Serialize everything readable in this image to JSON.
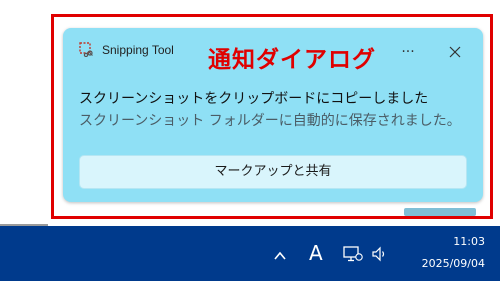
{
  "toast": {
    "app_name": "Snipping Tool",
    "annotation_label": "通知ダイアログ",
    "more_label": "···",
    "title": "スクリーンショットをクリップボードにコピーしました",
    "body": "スクリーンショット フォルダーに自動的に保存されました。",
    "action_label": "マークアップと共有",
    "icons": {
      "app": "snipping-tool-icon",
      "more": "more-icon",
      "close": "close-icon"
    }
  },
  "taskbar": {
    "ime_indicator": "A",
    "time": "11:03",
    "date": "2025/09/04",
    "icons": [
      "chevron-up-icon",
      "network-icon",
      "volume-icon"
    ]
  },
  "colors": {
    "toast_bg": "#8fe0f5",
    "annotation": "#e00000",
    "taskbar": "#003a8c"
  }
}
